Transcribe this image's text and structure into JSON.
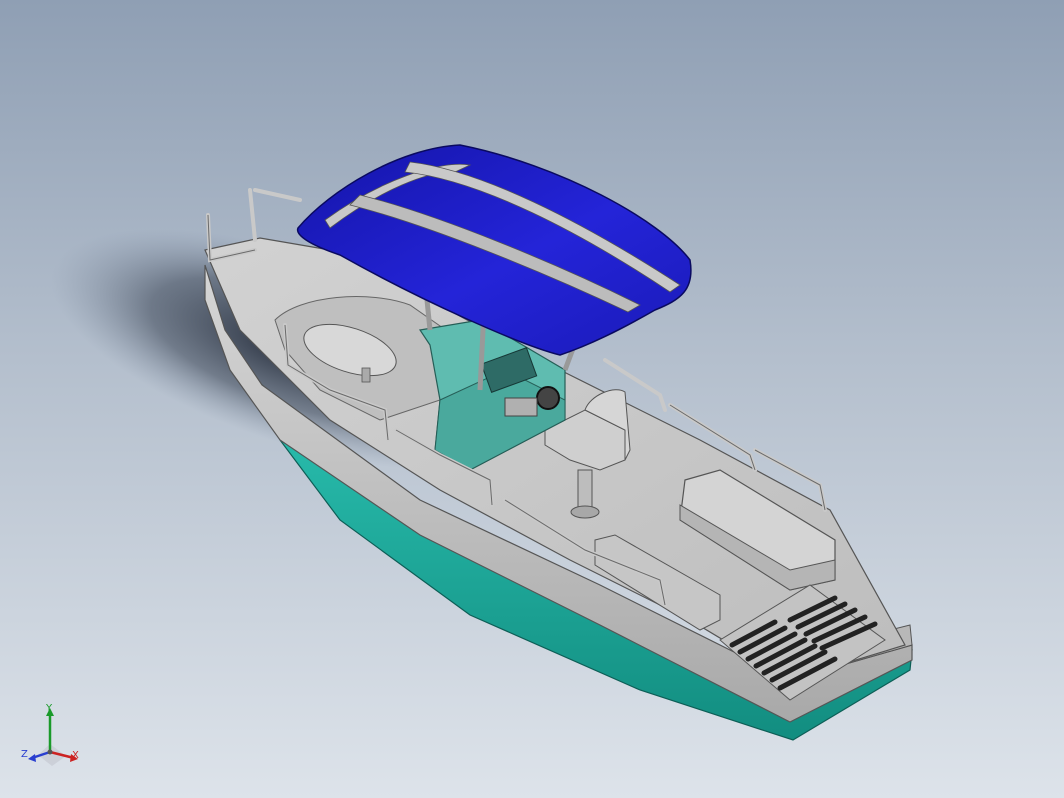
{
  "viewport": {
    "background_top": "#8f9fb4",
    "background_bottom": "#dde3ea"
  },
  "model": {
    "canopy_color": "#1c1cc0",
    "hull_bottom_color": "#1aa89a",
    "deck_color": "#c9c9c9",
    "console_color": "#5fbcb0",
    "rail_color": "#d8d8d8"
  },
  "triad": {
    "y_label": "Y",
    "z_label": "Z",
    "x_label": "X",
    "y_color": "#1a9a2a",
    "z_color": "#2a3fd0",
    "x_color": "#cc2222"
  }
}
